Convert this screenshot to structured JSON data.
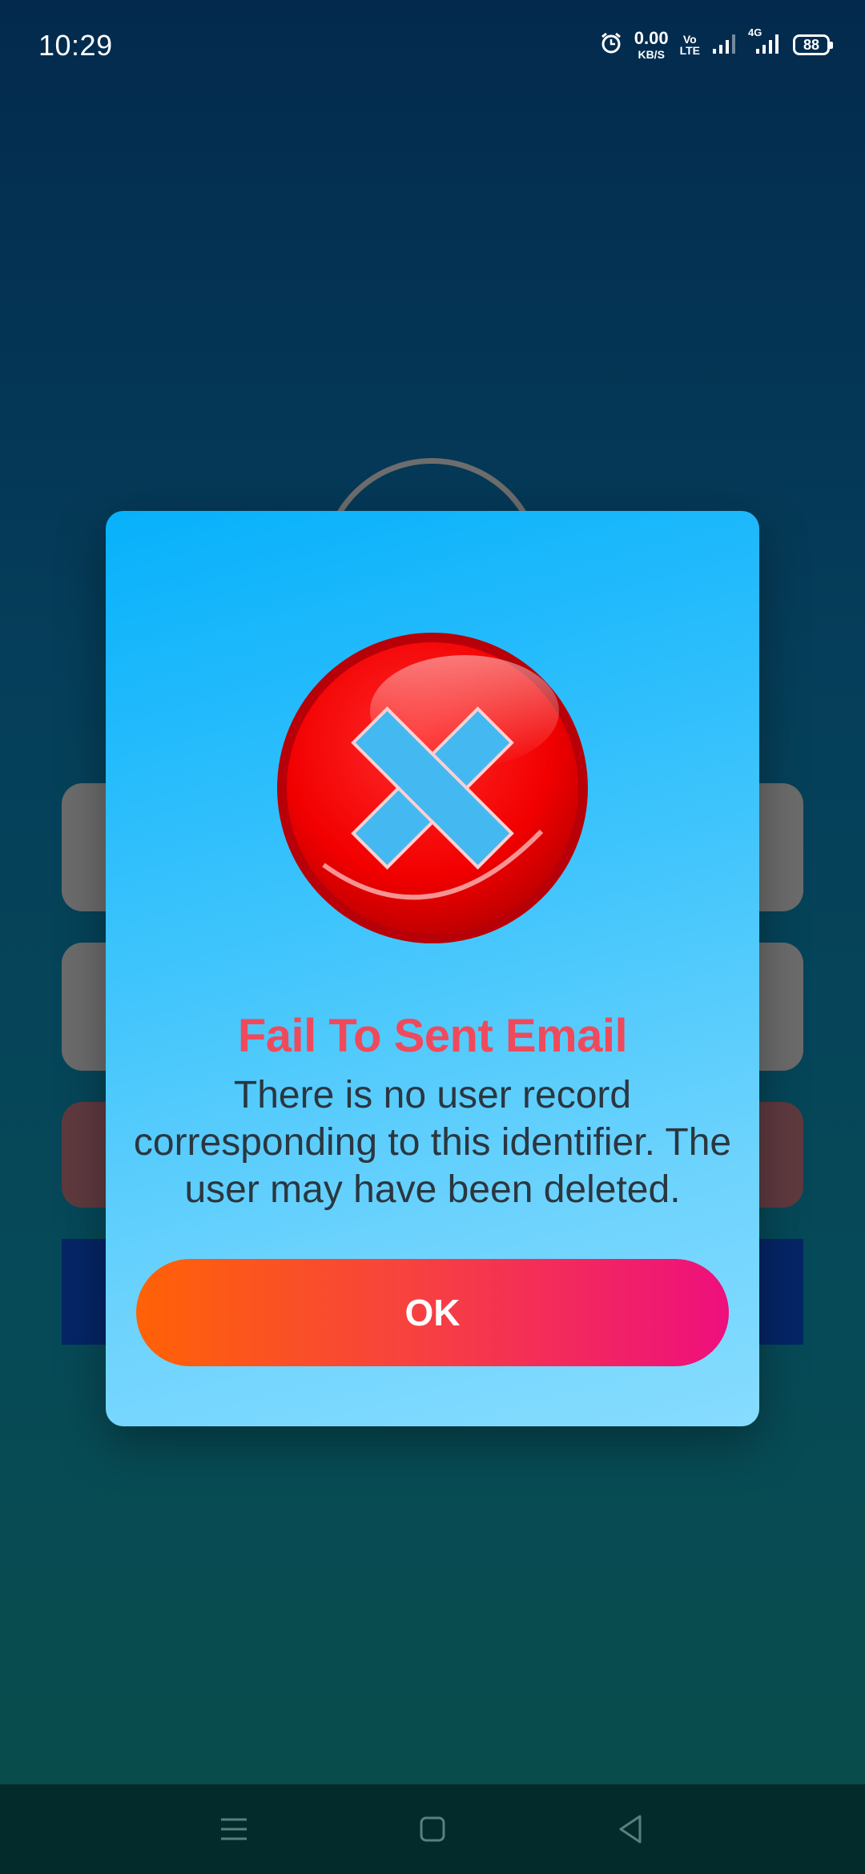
{
  "status_bar": {
    "time": "10:29",
    "net_speed_value": "0.00",
    "net_speed_unit": "KB/S",
    "volte_top": "Vo",
    "volte_bottom": "LTE",
    "network_label": "4G",
    "battery_level": "88",
    "icons": [
      "alarm-icon",
      "signal-icon",
      "signal-4g-icon",
      "battery-icon"
    ]
  },
  "dialog": {
    "title": "Fail To Sent Email",
    "message": "There is no user record corresponding to this identifier. The user may have been deleted.",
    "ok_label": "OK",
    "icon": "error-x-icon"
  },
  "colors": {
    "title": "#ef4a5b",
    "button_gradient_start": "#ff6206",
    "button_gradient_end": "#ee0f7d",
    "dialog_top": "#07b1fb",
    "dialog_bottom": "#86dcff"
  },
  "nav_bar": {
    "icons": [
      "menu-icon",
      "home-icon",
      "back-icon"
    ]
  }
}
